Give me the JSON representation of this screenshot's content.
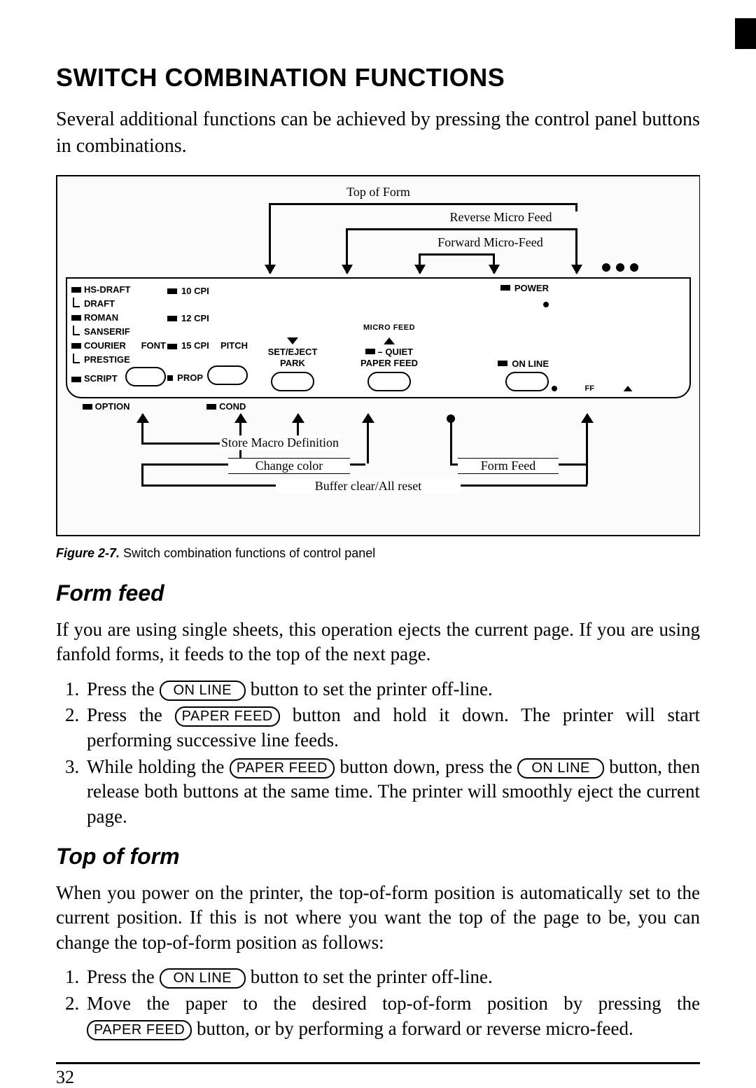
{
  "title": "SWITCH COMBINATION FUNCTIONS",
  "intro": "Several additional functions can be achieved by pressing the control panel buttons in combinations.",
  "figure": {
    "top_labels": {
      "tof": "Top of Form",
      "rev": "Reverse Micro Feed",
      "fwd": "Forward Micro-Feed"
    },
    "font_list": [
      "HS-DRAFT",
      "DRAFT",
      "ROMAN",
      "SANSERIF",
      "COURIER",
      "PRESTIGE",
      "SCRIPT"
    ],
    "font_btn_label": "FONT",
    "option_label": "OPTION",
    "pitch_list": [
      "10 CPI",
      "12 CPI",
      "15 CPI",
      "PROP"
    ],
    "cond_label": "COND",
    "pitch_btn_label": "PITCH",
    "micro_feed_label": "MICRO FEED",
    "set_eject_label1": "SET/EJECT",
    "set_eject_label2": "PARK",
    "quiet_label": "QUIET",
    "paper_feed_label": "PAPER FEED",
    "power_label": "POWER",
    "online_label": "ON LINE",
    "ff_label": "FF",
    "bottom_labels": {
      "store": "Store Macro Definition",
      "color": "Change color",
      "formfeed": "Form Feed",
      "buffer": "Buffer clear/All reset"
    }
  },
  "caption_prefix": "Figure 2-7.",
  "caption_text": " Switch combination functions of control panel",
  "sections": {
    "form_feed": {
      "heading": "Form feed",
      "intro": "If you are using single sheets, this operation ejects the current page. If you are using fanfold forms, it feeds to the top of the next page.",
      "steps": {
        "s1a": "Press the ",
        "s1b": " button to set the printer off-line.",
        "s2a": "Press the ",
        "s2b": " button and hold it down. The printer will start performing successive line feeds.",
        "s3a": "While holding the ",
        "s3b": " button down, press the ",
        "s3c": " button, then release both buttons at the same time. The printer will smoothly eject the current page."
      }
    },
    "top_of_form": {
      "heading": "Top of form",
      "intro": "When you power on the printer, the top-of-form position is automatically set to the current position. If this is not where you want the top of the page to be, you can change the top-of-form position as follows:",
      "steps": {
        "s1a": "Press the ",
        "s1b": " button to set the printer off-line.",
        "s2a": "Move the paper to the desired top-of-form position by pressing the ",
        "s2b": " button, or by performing a forward or reverse micro-feed."
      }
    }
  },
  "keys": {
    "online": "ON LINE",
    "paperfeed": "PAPER FEED"
  },
  "page_number": "32"
}
